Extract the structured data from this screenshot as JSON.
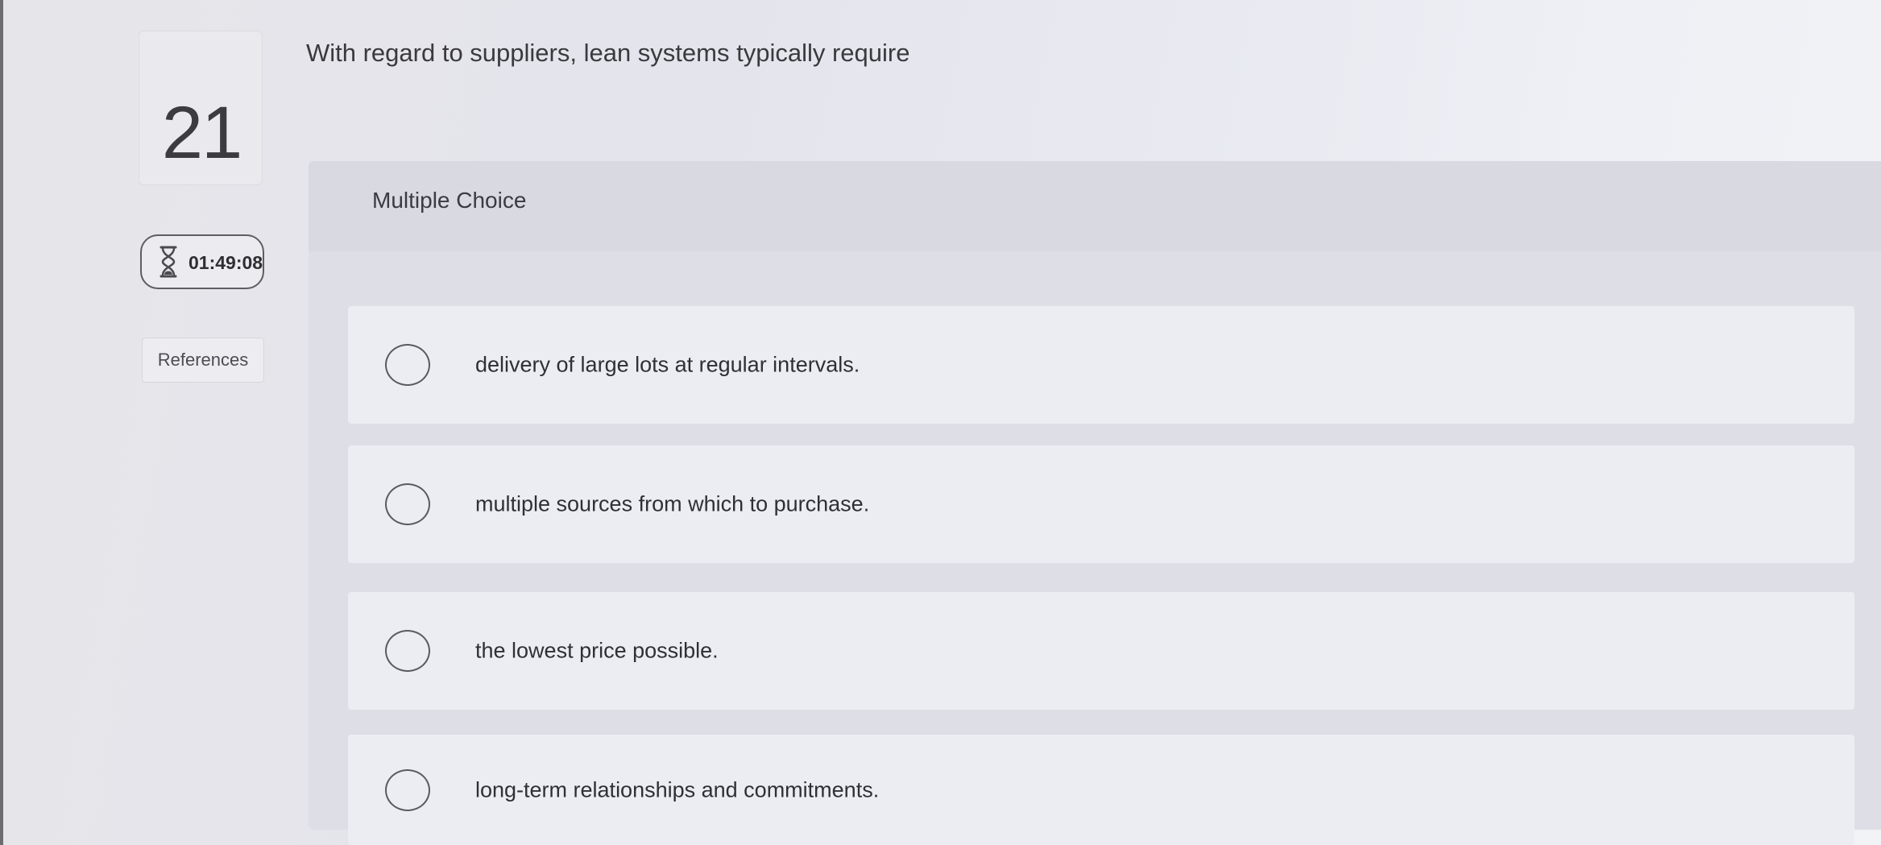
{
  "question": {
    "number": "21",
    "prompt": "With regard to suppliers, lean systems typically require"
  },
  "timer": {
    "icon": "hourglass-icon",
    "time": "01:49:08"
  },
  "references": {
    "label": "References"
  },
  "answer": {
    "type_label": "Multiple Choice",
    "options": [
      {
        "label": "delivery of large lots at regular intervals.",
        "selected": false
      },
      {
        "label": "multiple sources from which to purchase.",
        "selected": false
      },
      {
        "label": "the lowest price possible.",
        "selected": false
      },
      {
        "label": "long-term relationships and commitments.",
        "selected": false
      }
    ]
  }
}
